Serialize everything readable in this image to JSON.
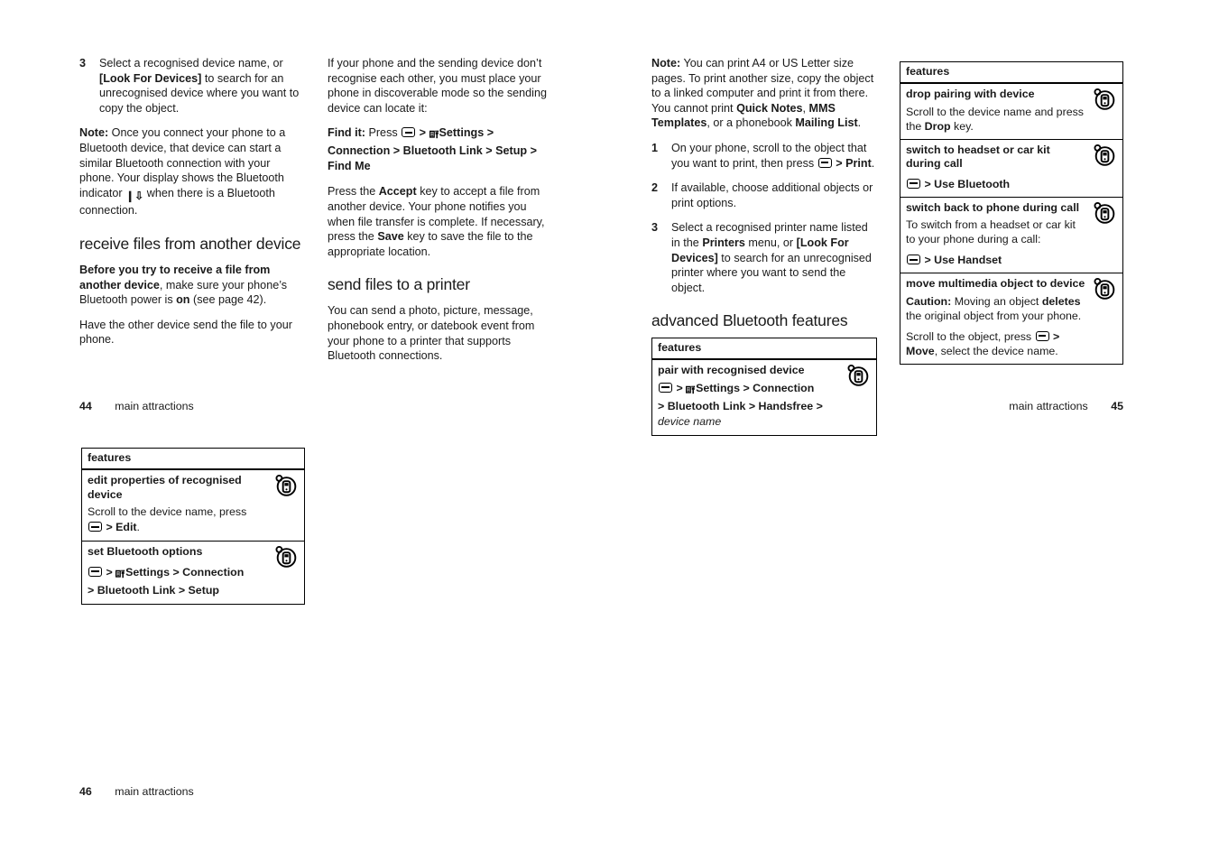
{
  "document": {
    "type": "manual-spread",
    "pages": [
      {
        "number": "44",
        "label": "main attractions",
        "align": "left"
      },
      {
        "number": "45",
        "label": "main attractions",
        "align": "right"
      },
      {
        "number": "46",
        "label": "main attractions",
        "align": "left"
      }
    ]
  },
  "col1": {
    "step3": {
      "num": "3",
      "part1": "Select a recognised device name, or ",
      "bold1": "[Look For Devices]",
      "part2": " to search for an unrecognised device where you want to copy the object."
    },
    "note": {
      "label": "Note:",
      "text1": " Once you connect your phone to a Bluetooth device, that device can start a similar Bluetooth connection with your phone. Your display shows the Bluetooth indicator ",
      "glyph": "bluetooth-icon",
      "text2": " when there is a Bluetooth connection."
    },
    "heading": "receive files from another device",
    "para1": {
      "bold1": "Before you try to receive a file from another device",
      "mid": ", make sure your phone’s Bluetooth power is ",
      "bold2": "on",
      "end": " (see page 42)."
    },
    "para2": "Have the other device send the file to your phone."
  },
  "col2": {
    "para1": "If your phone and the sending device don’t recognise each other, you must place your phone in discoverable mode so the sending device can locate it:",
    "find_it": {
      "label": "Find it:",
      "press": " Press ",
      "menu_icon": "menu-key-icon",
      "sep1": " > ",
      "settings_icon": "settings-tools-icon",
      "settings": "Settings",
      "sep2": " > ",
      "connection": "Connection",
      "sep3": " > ",
      "bluetooth_link": "Bluetooth Link",
      "sep4": " > ",
      "setup": "Setup",
      "sep5": " > ",
      "find_me": "Find Me"
    },
    "para2": {
      "t1": "Press the ",
      "b1": "Accept",
      "t2": " key to accept a file from another device. Your phone notifies you when file transfer is complete. If necessary, press the ",
      "b2": "Save",
      "t3": " key to save the file to the appropriate location."
    },
    "heading": "send files to a printer",
    "para3": "You can send a photo, picture, message, phonebook entry, or datebook event from your phone to a printer that supports Bluetooth connections."
  },
  "col3": {
    "note": {
      "label": "Note:",
      "t1": " You can print A4 or US Letter size pages. To print another size, copy the object to a linked computer and print it from there. You cannot print ",
      "b1": "Quick Notes",
      "t2": ", ",
      "b2": "MMS Templates",
      "t3": ", or a phonebook ",
      "b3": "Mailing List",
      "t4": "."
    },
    "step1": {
      "num": "1",
      "t1": "On your phone, scroll to the object that you want to print, then press ",
      "menu_icon": "menu-key-icon",
      "t2": " > ",
      "b1": "Print",
      "t3": "."
    },
    "step2": {
      "num": "2",
      "text": "If available, choose additional objects or print options."
    },
    "step3": {
      "num": "3",
      "t1": "Select a recognised printer name listed in the ",
      "b1": "Printers",
      "t2": " menu, or ",
      "b2": "[Look For Devices]",
      "t3": " to search for an unrecognised printer where you want to send the object."
    },
    "heading": "advanced Bluetooth features",
    "table": {
      "header": "features",
      "rows": [
        {
          "title": "pair with recognised device",
          "icon": "phone-feature-icon",
          "path": {
            "menu_icon": "menu-key-icon",
            "s1": " > ",
            "settings_icon": "settings-tools-icon",
            "settings": "Settings",
            "s2": " > ",
            "connection": "Connection",
            "s3": " > ",
            "bluetooth_link": "Bluetooth Link",
            "s4": " > ",
            "handsfree": "Handsfree",
            "s5": " > ",
            "device_name": "device name"
          }
        }
      ]
    }
  },
  "col4": {
    "table": {
      "header": "features",
      "row1": {
        "title": "drop pairing with device",
        "icon": "phone-feature-icon",
        "t1": "Scroll to the device name and press the ",
        "b1": "Drop",
        "t2": " key."
      },
      "row2": {
        "title": "switch to headset or car kit during call",
        "icon": "phone-feature-icon",
        "menu_icon": "menu-key-icon",
        "sep": " > ",
        "action": "Use Bluetooth"
      },
      "row3": {
        "title": "switch back to phone during call",
        "icon": "phone-feature-icon",
        "body": "To switch from a headset or car kit to your phone during a call:",
        "menu_icon": "menu-key-icon",
        "sep": " > ",
        "action": "Use Handset"
      },
      "row4": {
        "title": "move multimedia object to device",
        "icon": "phone-feature-icon",
        "caution_label": "Caution:",
        "caution_t1": " Moving an object ",
        "caution_b1": "deletes",
        "caution_t2": " the original object from your phone.",
        "l2_t1": "Scroll to the object, press ",
        "l2_menu": "menu-key-icon",
        "l2_t2": " > ",
        "l2_b1": "Move",
        "l2_t3": ", select the device name."
      }
    }
  },
  "col1b": {
    "table": {
      "header": "features",
      "row1": {
        "title": "edit properties of recognised device",
        "icon": "phone-feature-icon",
        "t1": "Scroll to the device name, press ",
        "menu_icon": "menu-key-icon",
        "t2": " > ",
        "b1": "Edit",
        "t3": "."
      },
      "row2": {
        "title": "set Bluetooth options",
        "icon": "phone-feature-icon",
        "menu_icon": "menu-key-icon",
        "s1": " > ",
        "settings_icon": "settings-tools-icon",
        "settings": "Settings",
        "s2": " > ",
        "connection": "Connection",
        "s3": " > ",
        "bluetooth_link": "Bluetooth Link",
        "s4": " > ",
        "setup": "Setup"
      }
    }
  },
  "colors": {
    "text": "#1a1a1a",
    "rule": "#000000",
    "background": "#ffffff"
  }
}
